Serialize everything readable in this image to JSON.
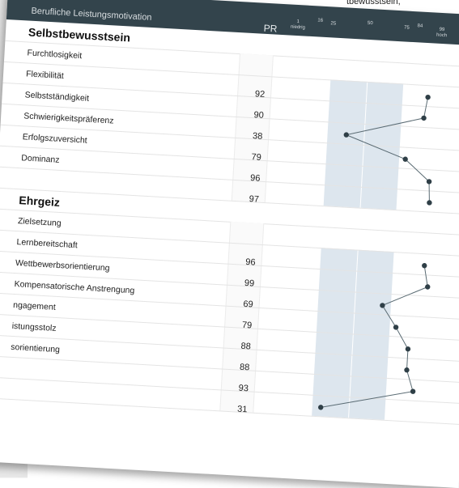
{
  "top_fragment": "tbewusstsein,",
  "header": {
    "title": "Berufliche Leistungsmotivation",
    "pr_label": "PR",
    "scale_ticks": [
      {
        "value": "1",
        "sub": "niedrig"
      },
      {
        "value": "16",
        "sub": ""
      },
      {
        "value": "25",
        "sub": ""
      },
      {
        "value": "50",
        "sub": ""
      },
      {
        "value": "75",
        "sub": ""
      },
      {
        "value": "84",
        "sub": ""
      },
      {
        "value": "99",
        "sub": "hoch"
      }
    ]
  },
  "sections": [
    {
      "title": "Selbstbewusstsein",
      "rows": [
        {
          "label": "Furchtlosigkeit",
          "value": ""
        },
        {
          "label": "Flexibilität",
          "value": "92"
        },
        {
          "label": "Selbstständigkeit",
          "value": "90"
        },
        {
          "label": "Schwierigkeitspräferenz",
          "value": "38"
        },
        {
          "label": "Erfolgszuversicht",
          "value": "79"
        },
        {
          "label": "Dominanz",
          "value": "96"
        },
        {
          "label": "",
          "value": "97"
        }
      ],
      "profile": [
        92,
        90,
        38,
        79,
        96,
        97
      ]
    },
    {
      "title": "Ehrgeiz",
      "rows": [
        {
          "label": "Zielsetzung",
          "value": ""
        },
        {
          "label": "Lernbereitschaft",
          "value": "96"
        },
        {
          "label": "Wettbewerbsorientierung",
          "value": "99"
        },
        {
          "label": "Kompensatorische Anstrengung",
          "value": "69"
        },
        {
          "label": "ngagement",
          "value": "79"
        },
        {
          "label": "istungsstolz",
          "value": "88"
        },
        {
          "label": "sorientierung",
          "value": "88"
        },
        {
          "label": "",
          "value": "93"
        },
        {
          "label": "",
          "value": "31"
        }
      ],
      "profile": [
        96,
        99,
        69,
        79,
        88,
        88,
        93,
        31
      ]
    }
  ],
  "colors": {
    "header_bg": "#33444c",
    "band": "#dde6ee",
    "line": "#5a6b73",
    "point": "#2f3f47"
  }
}
